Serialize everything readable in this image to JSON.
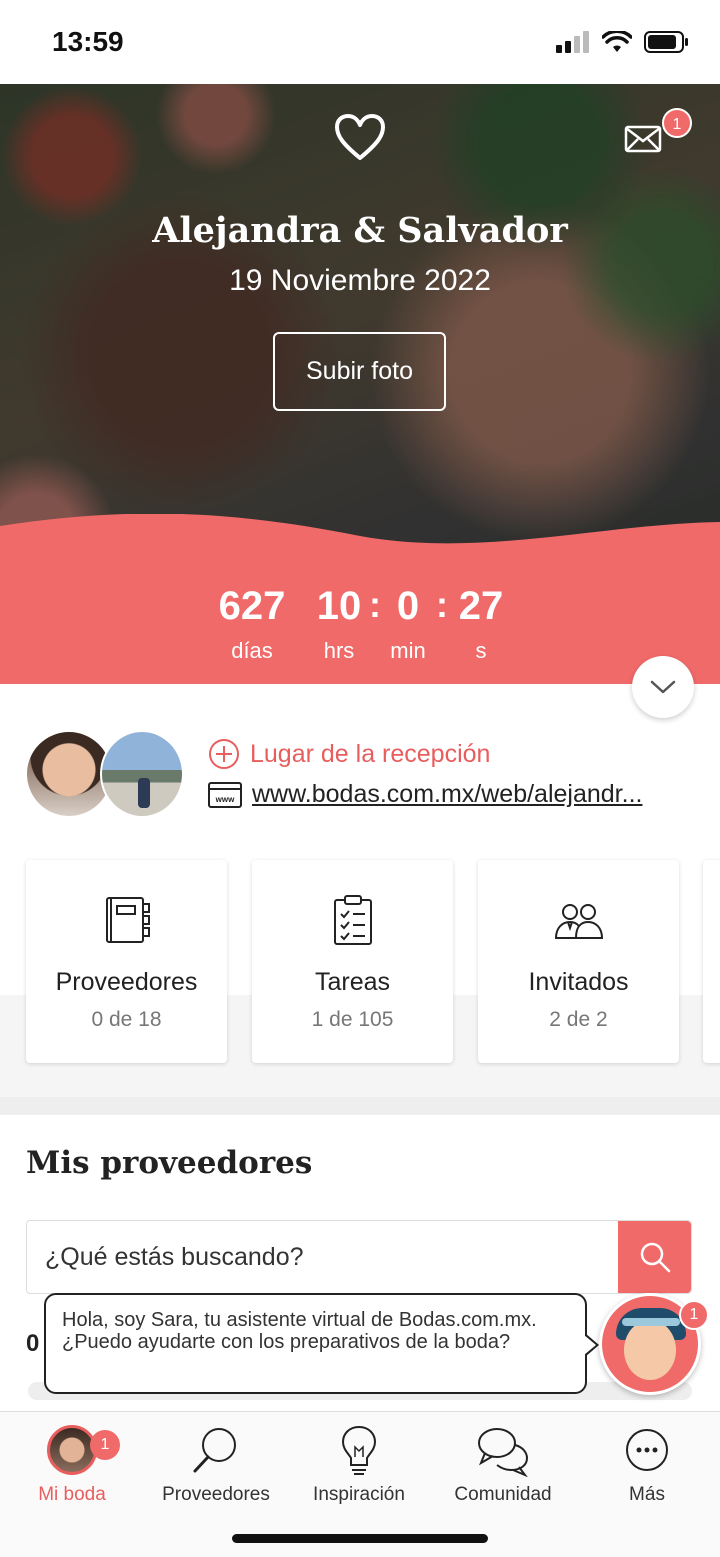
{
  "status_bar": {
    "time": "13:59"
  },
  "hero": {
    "couple_names": "Alejandra & Salvador",
    "date": "19 Noviembre 2022",
    "upload_button": "Subir foto",
    "mail_badge": "1"
  },
  "countdown": {
    "days": "627",
    "days_label": "días",
    "hours": "10",
    "hours_label": "hrs",
    "minutes": "0",
    "minutes_label": "min",
    "seconds": "27",
    "seconds_label": "s",
    "separator": ":"
  },
  "profile": {
    "venue_link": "Lugar de la recepción",
    "web_url": "www.bodas.com.mx/web/alejandr..."
  },
  "cards": [
    {
      "title": "Proveedores",
      "subtitle": "0 de 18",
      "icon": "notebook-icon"
    },
    {
      "title": "Tareas",
      "subtitle": "1 de 105",
      "icon": "checklist-icon"
    },
    {
      "title": "Invitados",
      "subtitle": "2 de 2",
      "icon": "guests-icon"
    }
  ],
  "providers": {
    "section_title": "Mis proveedores",
    "search_placeholder": "¿Qué estás buscando?",
    "hidden_count": "0"
  },
  "assistant": {
    "message": "Hola, soy Sara, tu asistente virtual de Bodas.com.mx. ¿Puedo ayudarte con los preparativos de la boda?",
    "badge": "1"
  },
  "tab_bar": {
    "items": [
      {
        "label": "Mi boda",
        "active": true,
        "badge": "1"
      },
      {
        "label": "Proveedores"
      },
      {
        "label": "Inspiración"
      },
      {
        "label": "Comunidad"
      },
      {
        "label": "Más"
      }
    ]
  },
  "colors": {
    "accent": "#f16a6a",
    "accent_text": "#e85e5e"
  }
}
